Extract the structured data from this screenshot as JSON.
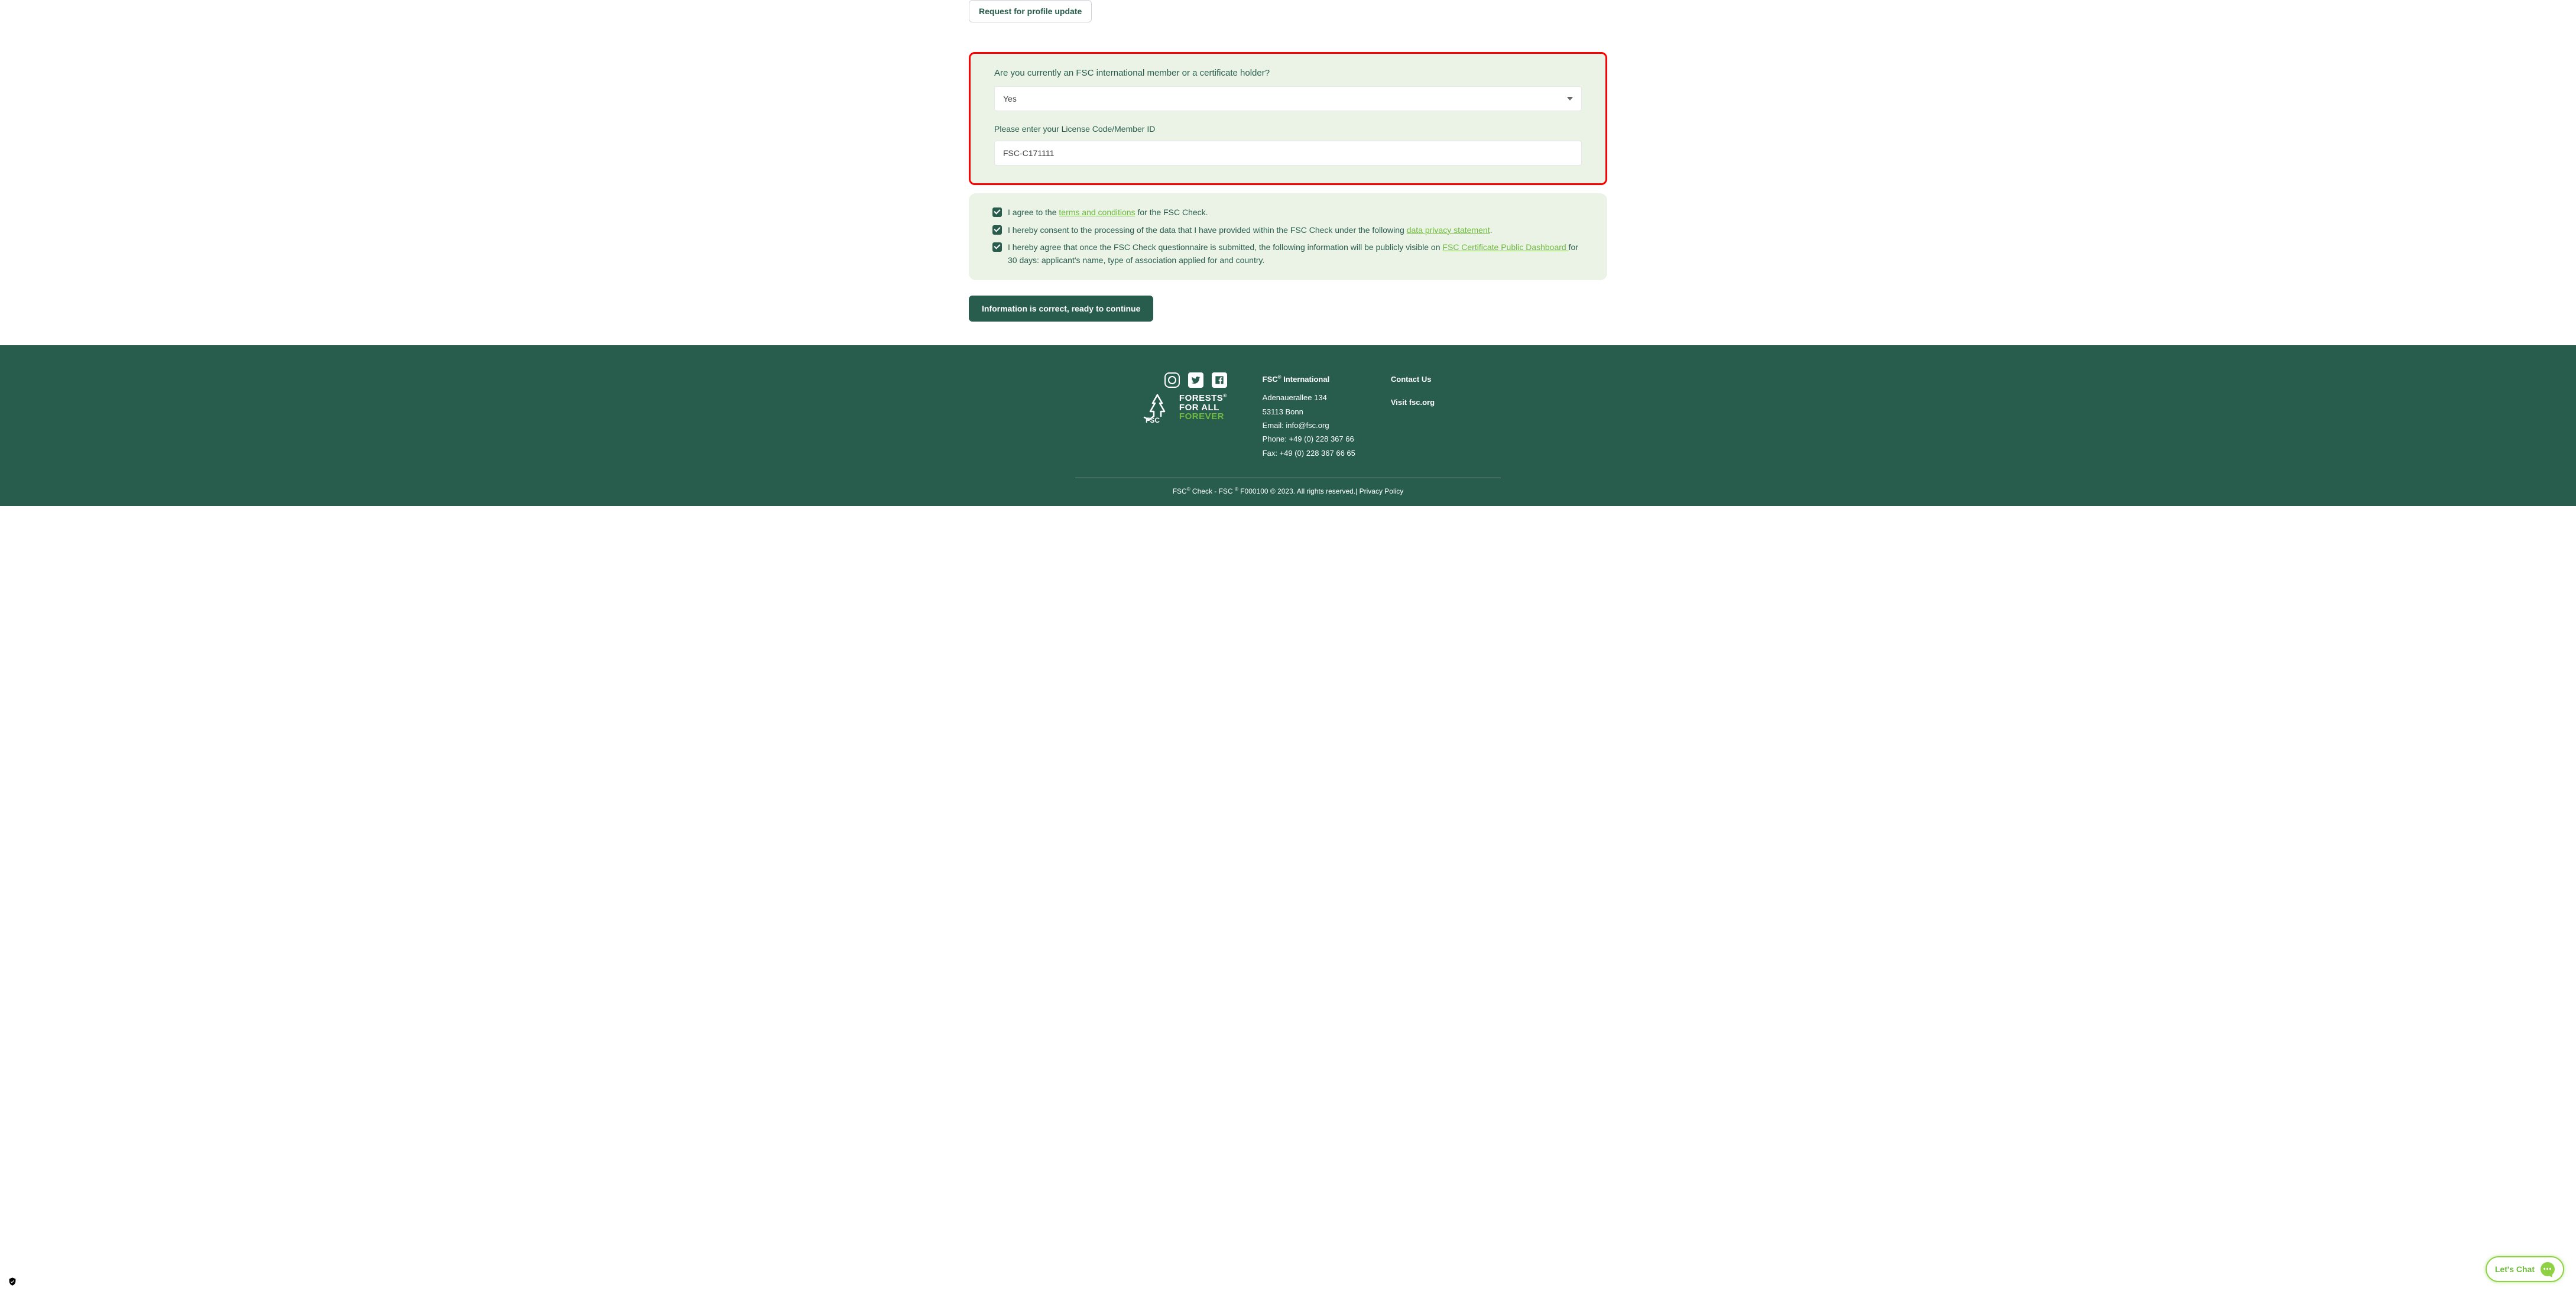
{
  "topButton": {
    "label": "Request for profile update"
  },
  "memberBox": {
    "question": "Are you currently an FSC international member or a certificate holder?",
    "selectValue": "Yes",
    "licenseLabel": "Please enter your License Code/Member ID",
    "licenseValue": "FSC-C171111"
  },
  "consent": {
    "row1_a": "I agree to the ",
    "row1_link": "terms and conditions",
    "row1_b": " for the FSC Check.",
    "row2_a": "I hereby consent to the processing of the data that I have provided within the FSC Check under the following ",
    "row2_link": "data privacy statement",
    "row2_b": ".",
    "row3_a": "I hereby agree that once the FSC Check questionnaire is submitted, the following information will be publicly visible on ",
    "row3_link": "FSC Certificate Public Dashboard ",
    "row3_b": "for 30 days: applicant's name, type of association applied for and country."
  },
  "continueBtn": "Information is correct, ready to continue",
  "footer": {
    "logoWords": {
      "line1": "FORESTS",
      "line2": "FOR ALL",
      "line3": "FOREVER"
    },
    "logoFSC": "FSC",
    "col1": {
      "hd_a": "FSC",
      "hd_b": " International",
      "addr1": "Adenauerallee 134",
      "addr2": "53113 Bonn",
      "email": "Email: info@fsc.org",
      "phone": "Phone: +49 (0) 228 367 66",
      "fax": "Fax: +49 (0) 228 367 66 65"
    },
    "col2": {
      "contact": "Contact Us",
      "visit": "Visit fsc.org"
    },
    "bottom_a": "FSC",
    "bottom_b": " Check - FSC ",
    "bottom_c": " F000100 © 2023. All rights reserved.| ",
    "bottom_pp": "Privacy Policy"
  },
  "chat": {
    "label": "Let's Chat",
    "dots": "•••"
  },
  "shield": "✔"
}
